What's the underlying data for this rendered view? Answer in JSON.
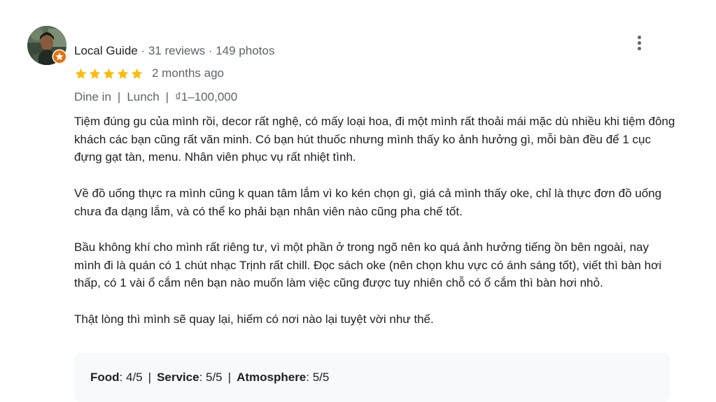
{
  "reviewer": {
    "avatar_icon": "user-photo-avatar",
    "badge_icon": "local-guide-star-badge",
    "badge_color": "#e8710a",
    "guide_label": "Local Guide",
    "sep": " · ",
    "reviews": "31 reviews",
    "photos": "149 photos"
  },
  "menu_icon": "more-vertical-icon",
  "rating": {
    "stars": 5,
    "max_stars": 5,
    "star_color": "#fbbc04",
    "time_ago": "2 months ago"
  },
  "tags": {
    "dining": "Dine in",
    "meal": "Lunch",
    "price": "₫1–100,000",
    "separator": "|"
  },
  "body": {
    "paragraphs": [
      "Tiệm đúng gu của mình rồi, decor rất nghệ, có mấy loại hoa, đi một mình rất thoải mái mặc dù nhiều khi tiệm đông khách các bạn cũng rất văn minh. Có bạn hút thuốc nhưng mình thấy ko ảnh hưởng gì, mỗi bàn đều để 1 cục đựng gạt tàn, menu. Nhân viên phục vụ rất nhiệt tình.",
      "Về đồ uống thực ra mình cũng k quan tâm lắm vì ko kén chọn gì, giá cả mình thấy oke, chỉ là thực đơn đồ uống chưa đa dạng lắm, và có thể ko phải bạn nhân viên nào cũng pha chế tốt.",
      "Bầu không khí cho mình rất riêng tư, vì một phần ở trong ngõ nên ko quá ảnh hưởng tiếng ồn bên ngoài, nay mình đi là quán có 1 chút nhạc Trịnh rất chill. Đọc sách oke (nên chọn khu vực có ánh sáng tốt), viết thì bàn hơi thấp, có 1 vài ổ cắm nên bạn nào muốn làm việc cũng được tuy nhiên chỗ có ổ cắm thì bàn hơi nhỏ.",
      "Thật lòng thì mình sẽ quay lại, hiếm có nơi nào lại tuyệt vời như thế."
    ]
  },
  "attributes": {
    "separator": "|",
    "food_label": "Food",
    "food_value": ": 4/5",
    "service_label": "Service",
    "service_value": ": 5/5",
    "atmosphere_label": "Atmosphere",
    "atmosphere_value": ": 5/5"
  }
}
